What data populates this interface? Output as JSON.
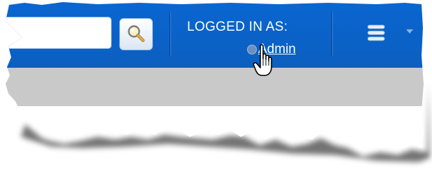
{
  "header": {
    "search": {
      "value": "",
      "placeholder": "",
      "button_icon": "magnifier-icon"
    },
    "login": {
      "label": "LOGGED IN AS:",
      "username": "Admin",
      "user_icon": "user-status-dot-icon"
    },
    "menu": {
      "icon": "hamburger-menu-icon",
      "dropdown_icon": "caret-down-icon"
    }
  },
  "colors": {
    "header_bar": "#0b63c8",
    "subheader_band": "#c9c9c9",
    "content": "#ffffff",
    "text_on_header": "#ffffff"
  }
}
